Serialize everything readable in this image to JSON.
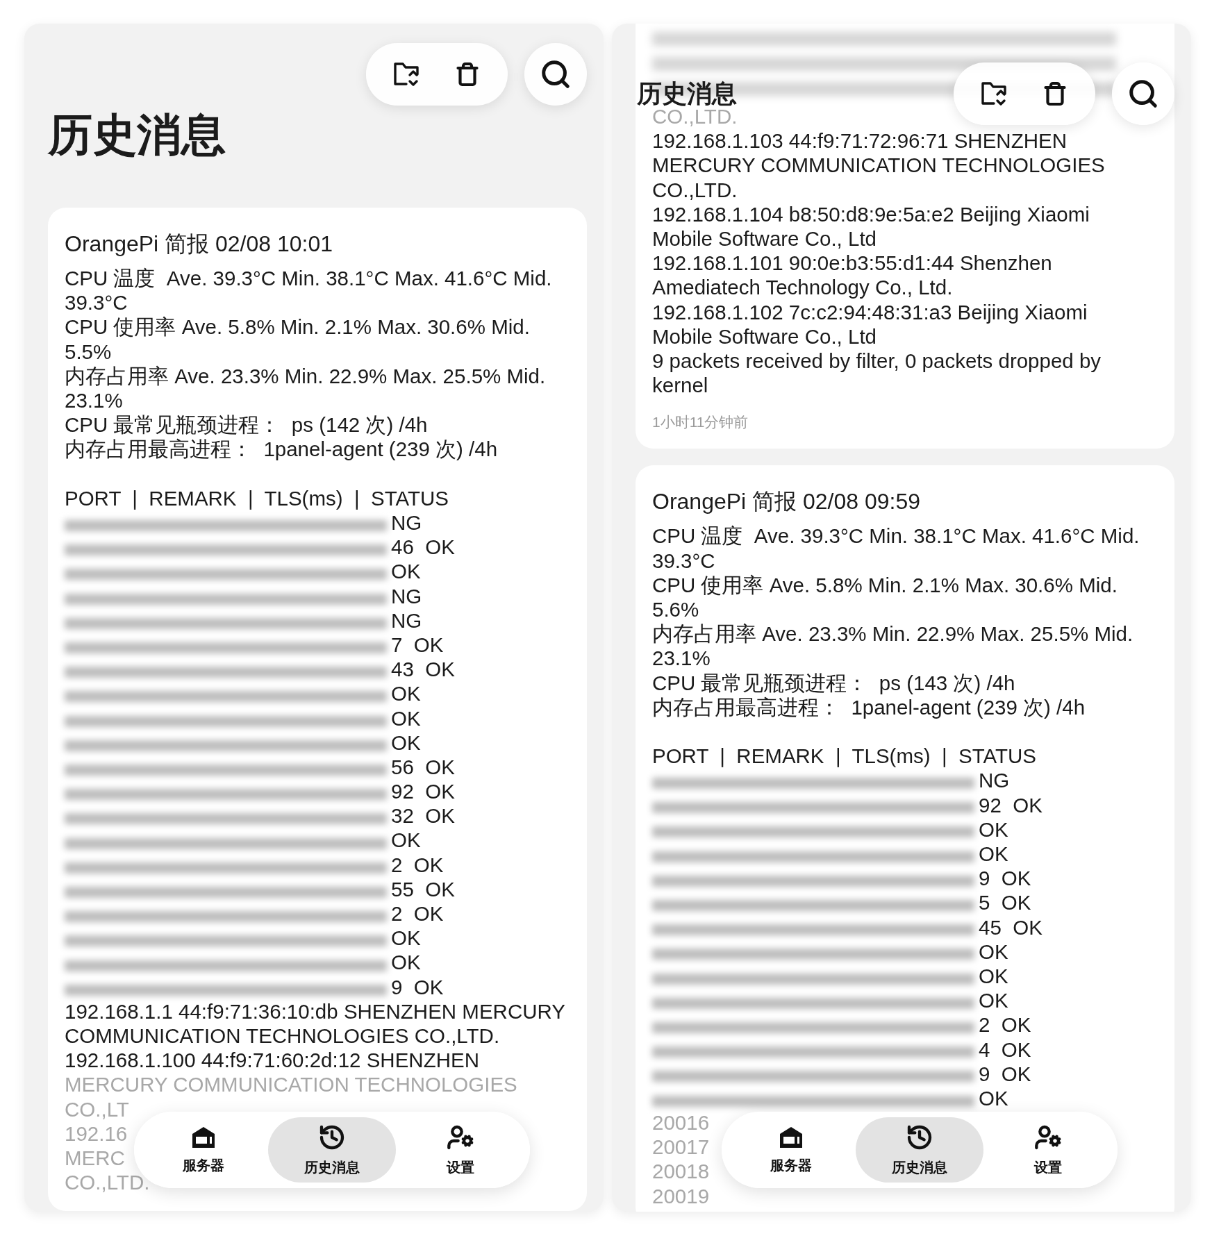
{
  "screens": [
    {
      "header": {
        "title": "历史消息",
        "kind": "large"
      },
      "cards": [
        {
          "title": "OrangePi 简报 02/08 10:01",
          "stats": [
            "CPU 温度  Ave. 39.3°C Min. 38.1°C Max. 41.6°C Mid. 39.3°C",
            "CPU 使用率 Ave. 5.8% Min. 2.1% Max. 30.6% Mid. 5.5%",
            "内存占用率 Ave. 23.3% Min. 22.9% Max. 25.5% Mid. 23.1%",
            "CPU 最常见瓶颈进程：  ps (142 次) /4h",
            "内存占用最高进程：  1panel-agent (239 次) /4h"
          ],
          "table_header": "PORT  |  REMARK  |  TLS(ms)  |  STATUS",
          "status_rows": [
            "NG",
            "46  OK",
            "OK",
            "NG",
            "NG",
            "7  OK",
            "43  OK",
            "OK",
            "OK",
            "OK",
            "56  OK",
            "92  OK",
            "32  OK",
            "OK",
            "2  OK",
            "55  OK",
            "2  OK",
            "OK",
            "OK",
            "9  OK"
          ],
          "lines": [
            {
              "text": "192.168.1.1 44:f9:71:36:10:db SHENZHEN MERCURY",
              "faded": false
            },
            {
              "text": "COMMUNICATION TECHNOLOGIES CO.,LTD.",
              "faded": false
            },
            {
              "text": "192.168.1.100 44:f9:71:60:2d:12 SHENZHEN",
              "faded": false
            },
            {
              "text": "MERCURY COMMUNICATION TECHNOLOGIES",
              "faded": true
            },
            {
              "text": "CO.,LT",
              "faded": true
            },
            {
              "text": "192.16",
              "faded": true
            },
            {
              "text": "MERC",
              "faded": true
            },
            {
              "text": "CO.,LTD.",
              "faded": true
            }
          ]
        }
      ],
      "nav": [
        {
          "label": "服务器",
          "selected": false
        },
        {
          "label": "历史消息",
          "selected": true
        },
        {
          "label": "设置",
          "selected": false
        }
      ]
    },
    {
      "header": {
        "title": "历史消息",
        "kind": "inline"
      },
      "cards": [
        {
          "lines": [
            {
              "text": "CO.,LTD.",
              "faded": true
            },
            {
              "text": "192.168.1.103 44:f9:71:72:96:71 SHENZHEN",
              "faded": false
            },
            {
              "text": "MERCURY COMMUNICATION TECHNOLOGIES",
              "faded": false
            },
            {
              "text": "CO.,LTD.",
              "faded": false
            },
            {
              "text": "192.168.1.104 b8:50:d8:9e:5a:e2 Beijing Xiaomi",
              "faded": false
            },
            {
              "text": "Mobile Software Co., Ltd",
              "faded": false
            },
            {
              "text": "192.168.1.101 90:0e:b3:55:d1:44 Shenzhen",
              "faded": false
            },
            {
              "text": "Amediatech Technology Co., Ltd.",
              "faded": false
            },
            {
              "text": "192.168.1.102 7c:c2:94:48:31:a3 Beijing Xiaomi",
              "faded": false
            },
            {
              "text": "Mobile Software Co., Ltd",
              "faded": false
            },
            {
              "text": "9 packets received by filter, 0 packets dropped by",
              "faded": false
            },
            {
              "text": "kernel",
              "faded": false
            }
          ],
          "time": "1小时11分钟前"
        },
        {
          "title": "OrangePi 简报 02/08 09:59",
          "stats": [
            "CPU 温度  Ave. 39.3°C Min. 38.1°C Max. 41.6°C Mid. 39.3°C",
            "CPU 使用率 Ave. 5.8% Min. 2.1% Max. 30.6% Mid. 5.6%",
            "内存占用率 Ave. 23.3% Min. 22.9% Max. 25.5% Mid. 23.1%",
            "CPU 最常见瓶颈进程：  ps (143 次) /4h",
            "内存占用最高进程：  1panel-agent (239 次) /4h"
          ],
          "table_header": "PORT  |  REMARK  |  TLS(ms)  |  STATUS",
          "status_rows": [
            "NG",
            "92  OK",
            "OK",
            "OK",
            "9  OK",
            "5  OK",
            "45  OK",
            "OK",
            "OK",
            "OK",
            "2  OK",
            "4  OK",
            "9  OK",
            "OK"
          ],
          "lines": [
            {
              "text": "20016",
              "faded": true
            },
            {
              "text": "20017",
              "faded": true
            },
            {
              "text": "20018",
              "faded": true
            },
            {
              "text": "20019",
              "faded": true
            }
          ]
        }
      ],
      "nav": [
        {
          "label": "服务器",
          "selected": false
        },
        {
          "label": "历史消息",
          "selected": true
        },
        {
          "label": "设置",
          "selected": false
        }
      ]
    }
  ]
}
